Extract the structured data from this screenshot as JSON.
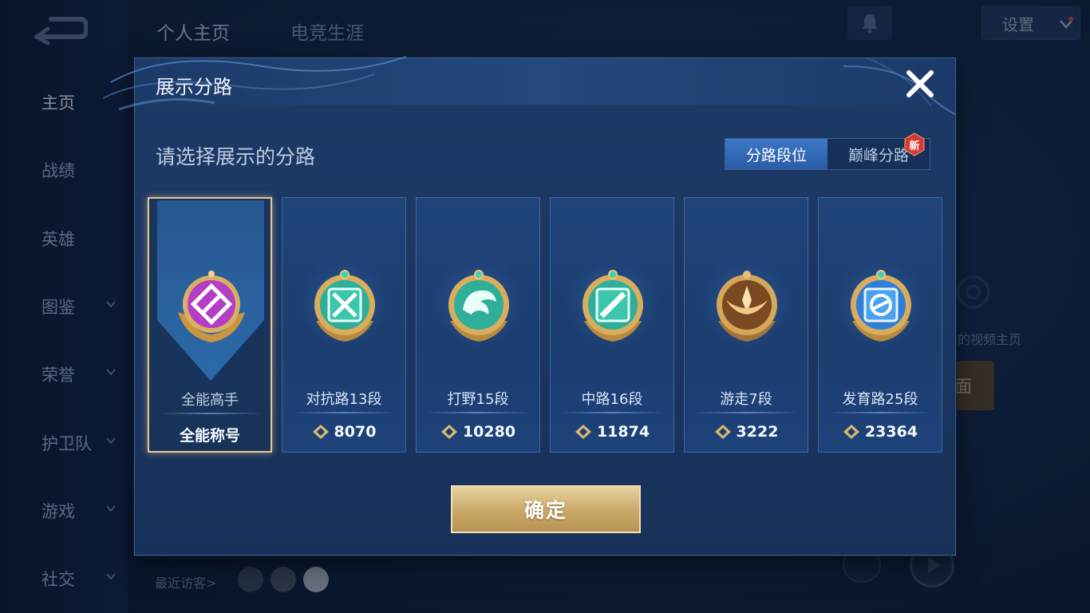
{
  "background": {
    "top_tabs": [
      "个人主页",
      "电竞生涯"
    ],
    "nav_items": [
      {
        "label": "主页",
        "has_chevron": false,
        "active": true
      },
      {
        "label": "战绩",
        "has_chevron": false,
        "active": false
      },
      {
        "label": "英雄",
        "has_chevron": false,
        "active": false
      },
      {
        "label": "图鉴",
        "has_chevron": true,
        "active": false
      },
      {
        "label": "荣誉",
        "has_chevron": true,
        "active": false
      },
      {
        "label": "护卫队",
        "has_chevron": true,
        "active": false
      },
      {
        "label": "游戏",
        "has_chevron": true,
        "active": false
      },
      {
        "label": "社交",
        "has_chevron": true,
        "active": false
      }
    ],
    "settings_label": "设置",
    "recent_visitors_label": "最近访客>",
    "right_partial_text": "的视频主页",
    "right_partial_button": "面"
  },
  "dialog": {
    "title": "展示分路",
    "subtitle": "请选择展示的分路",
    "segments": [
      {
        "label": "分路段位",
        "active": true
      },
      {
        "label": "巅峰分路",
        "active": false
      }
    ],
    "new_badge_text": "新",
    "cards": [
      {
        "name": "全能高手",
        "footer": "全能称号",
        "score": null,
        "selected": true,
        "icon": "all-round-emblem-icon",
        "color": "#b43fc4"
      },
      {
        "name": "对抗路13段",
        "footer": null,
        "score": "8070",
        "selected": false,
        "icon": "clash-lane-emblem-icon",
        "color": "#2fae9a"
      },
      {
        "name": "打野15段",
        "footer": null,
        "score": "10280",
        "selected": false,
        "icon": "jungle-emblem-icon",
        "color": "#2fae9a"
      },
      {
        "name": "中路16段",
        "footer": null,
        "score": "11874",
        "selected": false,
        "icon": "mid-lane-emblem-icon",
        "color": "#2fae9a"
      },
      {
        "name": "游走7段",
        "footer": null,
        "score": "3222",
        "selected": false,
        "icon": "roam-emblem-icon",
        "color": "#c78a3c"
      },
      {
        "name": "发育路25段",
        "footer": null,
        "score": "23364",
        "selected": false,
        "icon": "farm-lane-emblem-icon",
        "color": "#3c8fe0"
      }
    ],
    "confirm_label": "确定"
  },
  "colors": {
    "accent_gold": "#e5c690",
    "segment_active": "#3b78c6"
  }
}
